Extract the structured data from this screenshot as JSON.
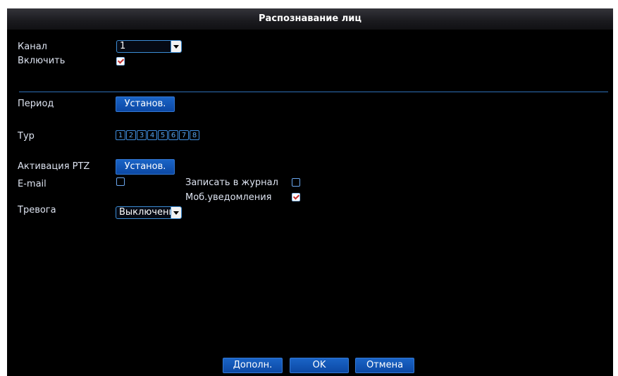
{
  "window": {
    "title": "Распознавание лиц"
  },
  "form": {
    "channel": {
      "label": "Канал",
      "value": "1"
    },
    "enable": {
      "label": "Включить",
      "checked": true
    },
    "period": {
      "label": "Период",
      "button": "Установ."
    },
    "tour": {
      "label": "Тур",
      "items": [
        "1",
        "2",
        "3",
        "4",
        "5",
        "6",
        "7",
        "8"
      ]
    },
    "ptz": {
      "label": "Активация PTZ",
      "button": "Установ."
    },
    "email": {
      "label": "E-mail",
      "checked": false
    },
    "log": {
      "label": "Записать в журнал",
      "checked": false
    },
    "mobile": {
      "label": "Моб.уведомления",
      "checked": true
    },
    "alarm": {
      "label": "Тревога",
      "value": "Выключени"
    }
  },
  "footer": {
    "advanced": "Дополн.",
    "ok": "OK",
    "cancel": "Отмена"
  },
  "colors": {
    "background": "#000000",
    "accent": "#0c4fb0",
    "border": "#3c8dd6"
  }
}
